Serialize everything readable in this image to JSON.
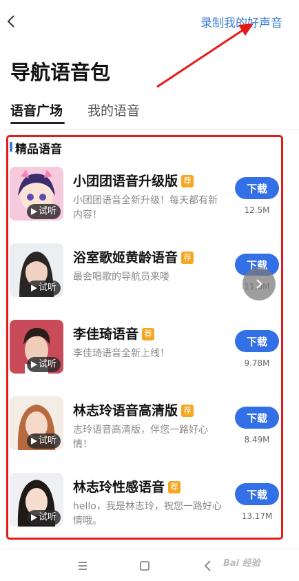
{
  "header": {
    "back_icon": "chevron-left-icon",
    "record_link": "录制我的好声音"
  },
  "page": {
    "title": "导航语音包"
  },
  "tabs": [
    {
      "label": "语音广场",
      "active": true
    },
    {
      "label": "我的语音",
      "active": false
    }
  ],
  "section": {
    "title": "精品语音"
  },
  "preview_label": "试听",
  "recommend_badge": "荐",
  "download_label": "下载",
  "items": [
    {
      "title": "小团团语音升级版",
      "desc": "小团团语音全新升级！每天都有新内容！",
      "size": "12.5M"
    },
    {
      "title": "浴室歌姬黄龄语音",
      "desc": "最会唱歌的导航员来喽",
      "size": "11.0M"
    },
    {
      "title": "李佳琦语音",
      "desc": "李佳琦语音全新上线！",
      "size": "9.78M"
    },
    {
      "title": "林志玲语音高清版",
      "desc": "志玲语音高清版，伴您一路好心情！",
      "size": "8.49M"
    },
    {
      "title": "林志玲性感语音",
      "desc": "hello，我是林志玲，祝您一路好心情哦。",
      "size": "13.17M"
    }
  ],
  "colors": {
    "accent": "#3370e6",
    "link": "#3a7bd5",
    "badge": "#f5a623",
    "annotation": "#e81919"
  },
  "bottom_nav": [
    "menu-icon",
    "home-square-icon",
    "back-triangle-icon"
  ],
  "watermark": "Bai 经验"
}
